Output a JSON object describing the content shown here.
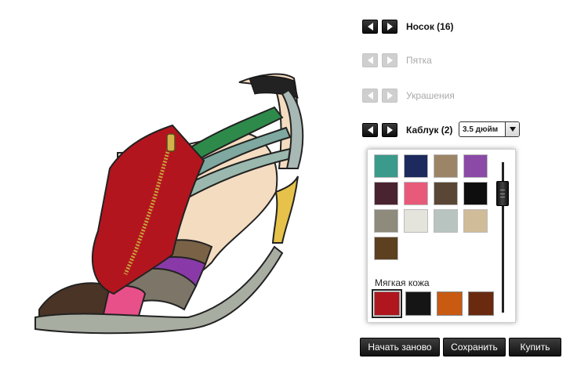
{
  "parts": [
    {
      "label": "Носок (16)",
      "active": true
    },
    {
      "label": "Пятка",
      "active": false
    },
    {
      "label": "Украшения",
      "active": false
    },
    {
      "label": "Каблук (2)",
      "active": true
    }
  ],
  "heel_height": {
    "selected": "3.5 дюйм"
  },
  "palette": {
    "swatches": [
      "#3a9a8c",
      "#1c2a5e",
      "#9c8466",
      "#8a4aa6",
      "#4a2330",
      "#e85a7a",
      "#5a4634",
      "#0e0e0e",
      "#8e8a7c",
      "#e4e4dc",
      "#b8c4c0",
      "#d0bc98",
      "#5c4020"
    ],
    "section_label": "Мягкая кожа",
    "leather_swatches": [
      "#b0161e",
      "#151515",
      "#c85a12",
      "#6a2a10"
    ],
    "leather_selected_index": 0
  },
  "actions": {
    "restart": "Начать заново",
    "save": "Сохранить",
    "buy": "Купить"
  }
}
